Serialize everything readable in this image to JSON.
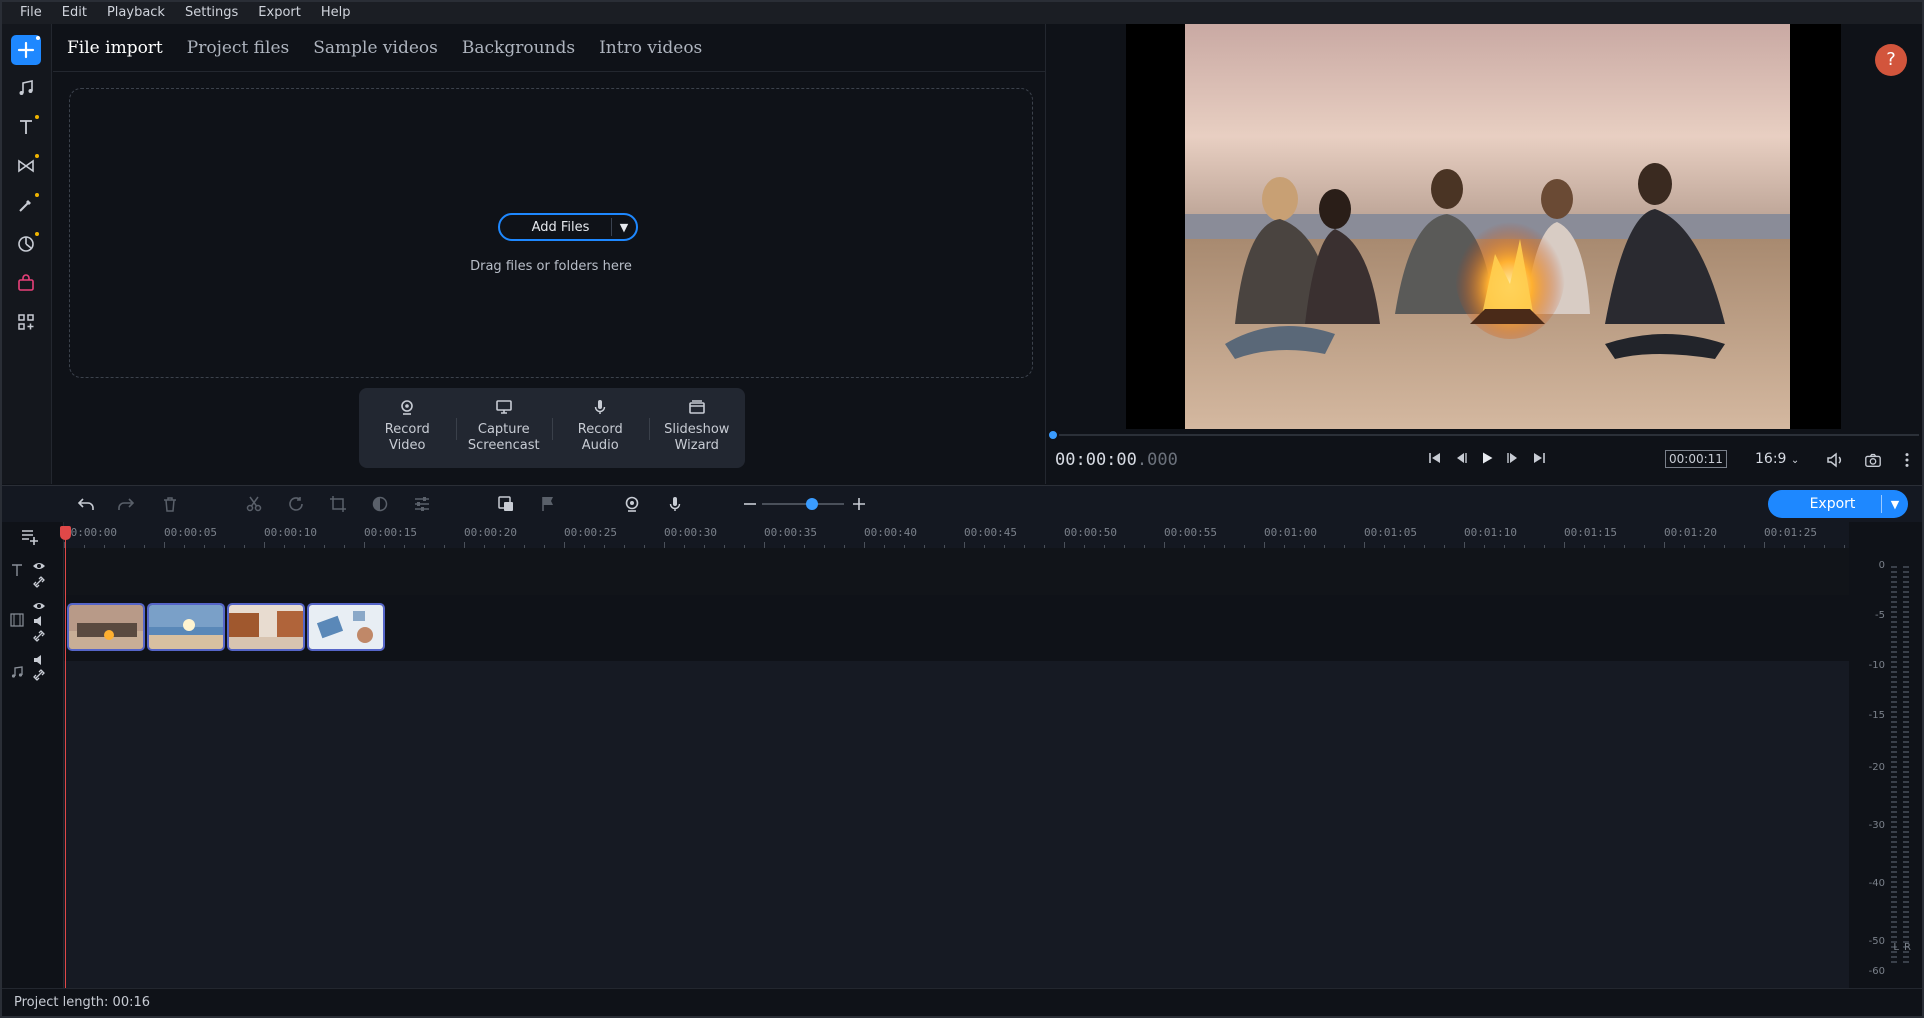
{
  "menu": [
    "File",
    "Edit",
    "Playback",
    "Settings",
    "Export",
    "Help"
  ],
  "import": {
    "tabs": [
      "File import",
      "Project files",
      "Sample videos",
      "Backgrounds",
      "Intro videos"
    ],
    "add_files_label": "Add Files",
    "drag_text": "Drag files or folders here",
    "record_buttons": [
      {
        "line1": "Record",
        "line2": "Video"
      },
      {
        "line1": "Capture",
        "line2": "Screencast"
      },
      {
        "line1": "Record",
        "line2": "Audio"
      },
      {
        "line1": "Slideshow",
        "line2": "Wizard"
      }
    ]
  },
  "player": {
    "timecode_main": "00:00:00",
    "timecode_ms": ".000",
    "duration": "00:00:11",
    "aspect": "16:9",
    "help": "?"
  },
  "timeline": {
    "export_label": "Export",
    "ruler": [
      "00:00:00",
      "00:00:05",
      "00:00:10",
      "00:00:15",
      "00:00:20",
      "00:00:25",
      "00:00:30",
      "00:00:35",
      "00:00:40",
      "00:00:45",
      "00:00:50",
      "00:00:55",
      "00:01:00",
      "00:01:05",
      "00:01:10",
      "00:01:15",
      "00:01:20",
      "00:01:25"
    ],
    "clips": 4
  },
  "meter": {
    "labels": [
      "0",
      "-5",
      "-10",
      "-15",
      "-20",
      "-30",
      "-40",
      "-50",
      "-60"
    ],
    "channels": [
      "L",
      "R"
    ]
  },
  "status": {
    "project_length": "Project length: 00:16"
  },
  "colors": {
    "accent": "#1e88ff",
    "playhead": "#e04848",
    "help": "#d2553c"
  }
}
